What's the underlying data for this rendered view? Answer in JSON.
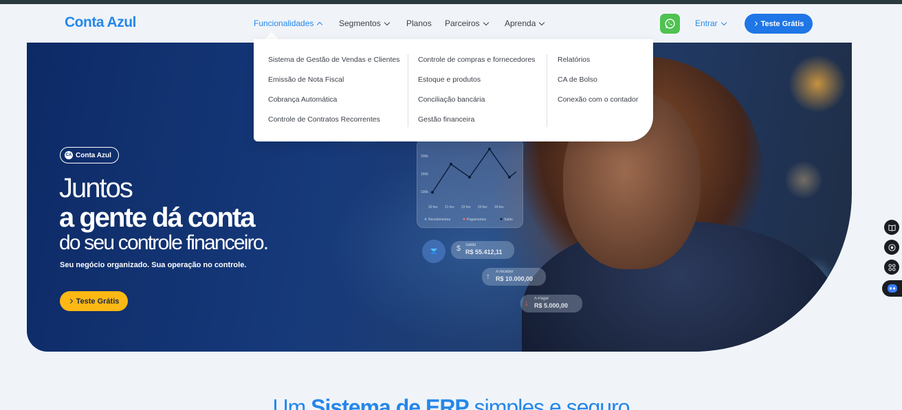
{
  "brand": {
    "name": "Conta Azul",
    "accent": "#2687e9",
    "yellow": "#fdb813"
  },
  "nav": {
    "items": [
      {
        "label": "Funcionalidades",
        "has_caret": true,
        "active": true
      },
      {
        "label": "Segmentos",
        "has_caret": true
      },
      {
        "label": "Planos",
        "has_caret": false
      },
      {
        "label": "Parceiros",
        "has_caret": true
      },
      {
        "label": "Aprenda",
        "has_caret": true
      }
    ],
    "whatsapp_icon": "whatsapp-icon",
    "login_label": "Entrar",
    "cta_label": "Teste Grátis"
  },
  "dropdown": {
    "columns": [
      [
        "Sistema de Gestão de Vendas e Clientes",
        "Emissão de Nota Fiscal",
        "Cobrança Automática",
        "Controle de Contratos Recorrentes"
      ],
      [
        "Controle de compras e fornecedores",
        "Estoque e produtos",
        "Conciliação bancária",
        "Gestão financeira"
      ],
      [
        "Relatórios",
        "CA de Bolso",
        "Conexão com o contador"
      ]
    ]
  },
  "hero": {
    "badge": "Conta Azul",
    "badge_logo": "CA",
    "line1": "Juntos",
    "line2": "a gente dá conta",
    "line3": "do seu controle financeiro.",
    "subtitle": "Seu negócio organizado. Sua operação no controle.",
    "cta_label": "Teste Grátis",
    "cards": {
      "saldo_label": "Saldo",
      "saldo_value": "R$ 55.412,11",
      "receber_label": "A receber",
      "receber_value": "R$ 10.000,00",
      "pagar_label": "A Pagar",
      "pagar_value": "R$ 5.000,00"
    },
    "mini_chart": {
      "y_ticks": [
        "200k",
        "150k",
        "100k"
      ],
      "x_ticks": [
        "20 fev",
        "21 fev",
        "22 fev",
        "23 fev",
        "24 fev"
      ],
      "legend": [
        "Recebimentos",
        "Pagamentos",
        "Saldo"
      ]
    }
  },
  "section": {
    "title_pre": "Um",
    "title_bold": "Sistema de ERP",
    "title_post": "simples e seguro"
  }
}
